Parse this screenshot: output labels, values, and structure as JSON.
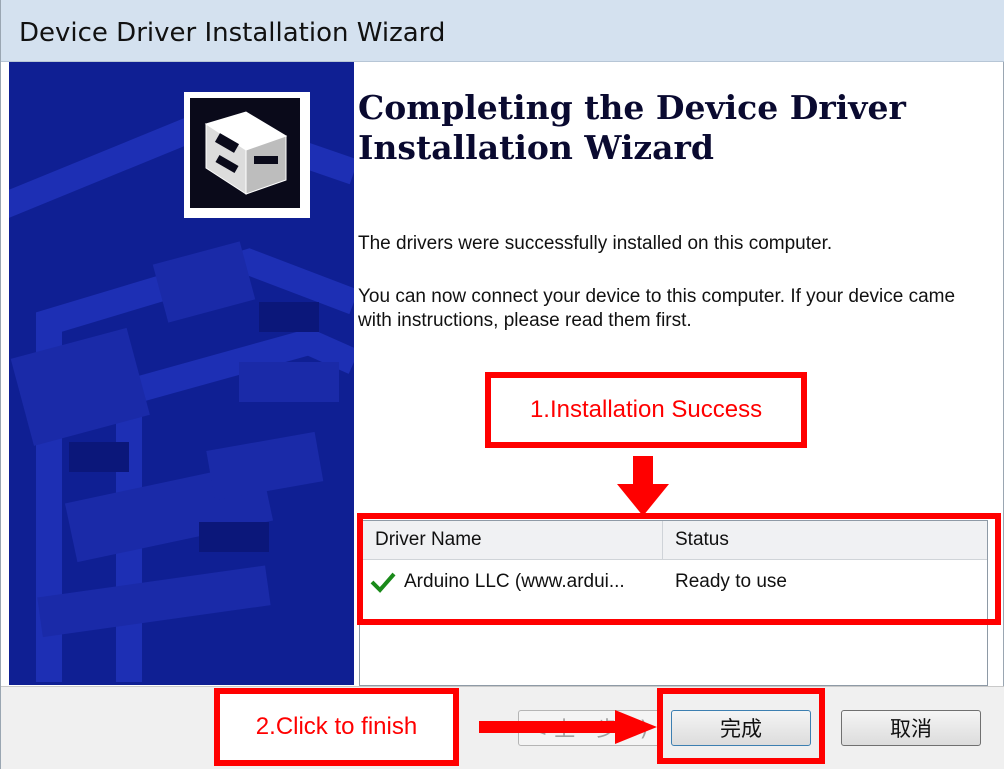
{
  "window": {
    "title": "Device Driver Installation Wizard"
  },
  "icons": {
    "wizard": "hardware-drive-icon",
    "check": "checkmark-icon"
  },
  "colors": {
    "sidepanel": "#0f1f93",
    "annotation": "#ff0000",
    "check": "#1a8a1a"
  },
  "main": {
    "heading": "Completing the Device Driver Installation Wizard",
    "message1": "The drivers were successfully installed on this computer.",
    "message2": "You can now connect your device to this computer. If your device came with instructions, please read them first."
  },
  "driver_list": {
    "columns": [
      "Driver Name",
      "Status"
    ],
    "rows": [
      {
        "name": "Arduino LLC (www.ardui...",
        "status": "Ready to use"
      }
    ]
  },
  "buttons": {
    "back": "< 上一步(B)",
    "finish": "完成",
    "cancel": "取消"
  },
  "annotations": {
    "step1": "1.Installation Success",
    "step2": "2.Click to finish"
  }
}
